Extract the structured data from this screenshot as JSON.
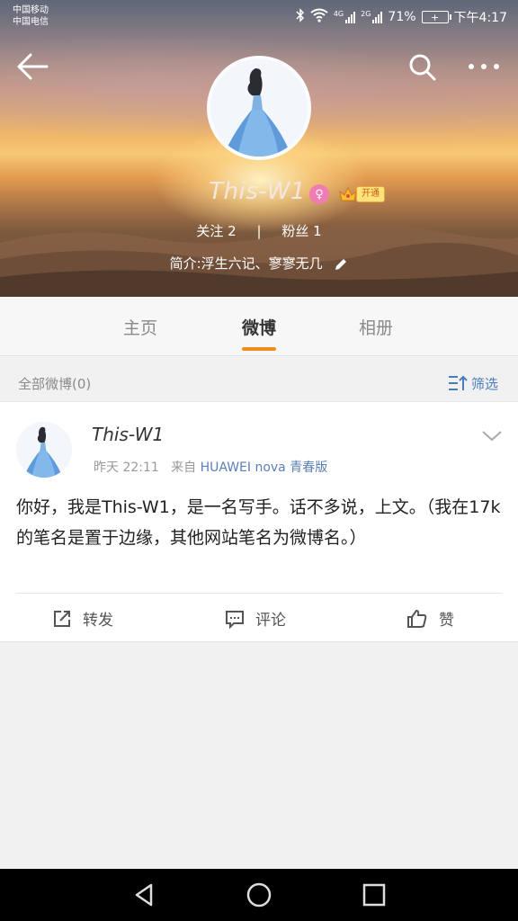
{
  "status_bar": {
    "carrier_1": "中国移动",
    "carrier_2": "中国电信",
    "network_1": "4G",
    "network_2": "2G",
    "battery": "71%",
    "time": "下午4:17"
  },
  "profile": {
    "username": "This-W1",
    "gender_badge_icon": "female-icon",
    "vip_label": "开通",
    "following_label": "关注",
    "following_count": "2",
    "followers_label": "粉丝",
    "followers_count": "1",
    "bio": "简介:浮生六记、寥寥无几"
  },
  "tabs": [
    {
      "label": "主页",
      "active": false
    },
    {
      "label": "微博",
      "active": true
    },
    {
      "label": "相册",
      "active": false
    }
  ],
  "filter": {
    "label": "全部微博(0)",
    "button_label": "筛选"
  },
  "post": {
    "author": "This-W1",
    "time": "昨天 22:11",
    "source_prefix": "来自",
    "source": "HUAWEI nova 青春版",
    "body": "你好，我是This-W1，是一名写手。话不多说，上文。（我在17k的笔名是置于边缘，其他网站笔名为微博名。）",
    "actions": {
      "repost": "转发",
      "comment": "评论",
      "like": "赞"
    }
  },
  "colors": {
    "accent_orange": "#f28a1c",
    "link_blue": "#5a7fb6",
    "gender_pink": "#f07cb4"
  }
}
